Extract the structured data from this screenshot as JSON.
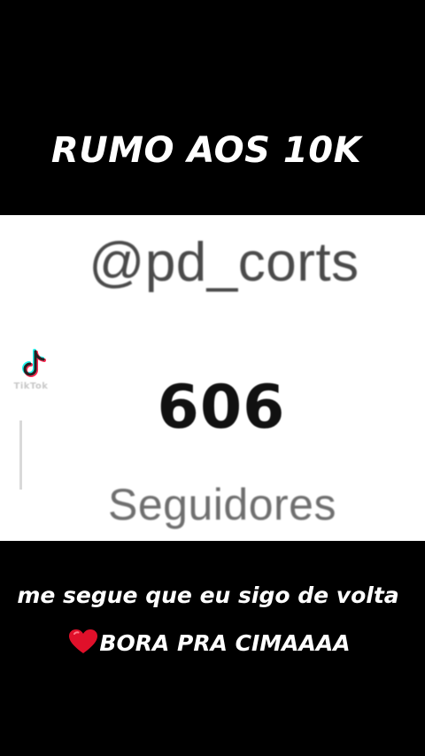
{
  "headline": "RUMO AOS 10K",
  "profile": {
    "handle": "@pd_corts",
    "follower_count": "606",
    "follower_label": "Seguidores"
  },
  "watermark": {
    "icon": "tiktok-logo-icon",
    "text": "TikTok"
  },
  "caption": {
    "part1": "me segue que eu sigo de volta ",
    "heart_icon": "red-heart-icon",
    "part2": "BORA PRA CIMAAAA"
  },
  "colors": {
    "background_band": "#000000",
    "panel": "#ffffff",
    "heart": "#e0102a",
    "tiktok_cyan": "#25f4ee",
    "tiktok_pink": "#fe2c55"
  }
}
